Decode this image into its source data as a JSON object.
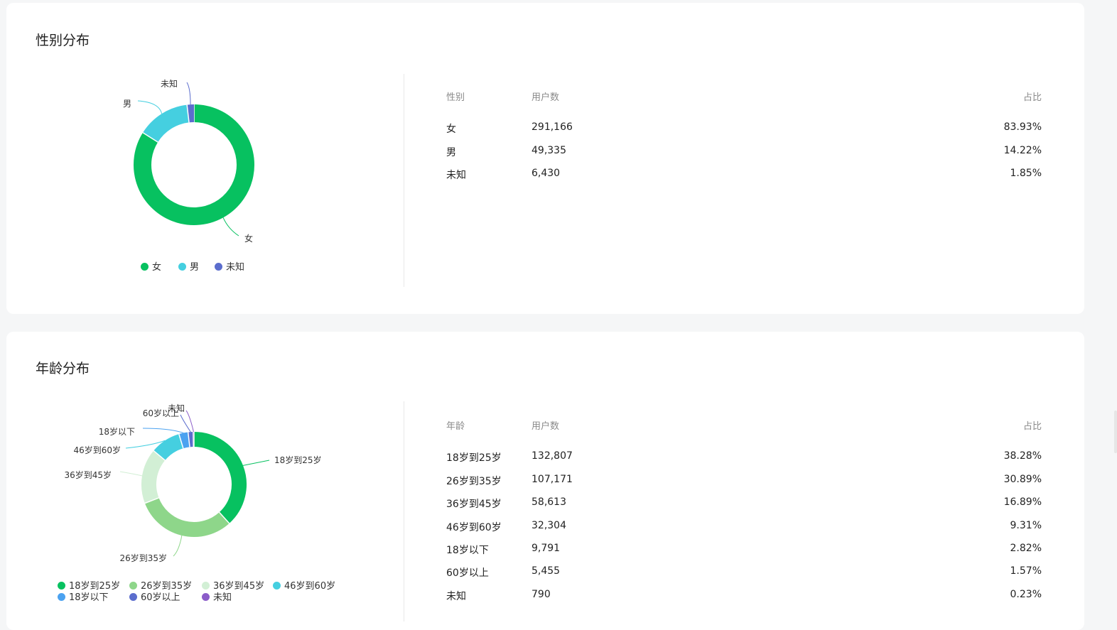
{
  "gender": {
    "title": "性别分布",
    "table": {
      "headers": [
        "性别",
        "用户数",
        "占比"
      ],
      "rows": [
        [
          "女",
          "291,166",
          "83.93%"
        ],
        [
          "男",
          "49,335",
          "14.22%"
        ],
        [
          "未知",
          "6,430",
          "1.85%"
        ]
      ]
    },
    "legend": [
      "女",
      "男",
      "未知"
    ]
  },
  "age": {
    "title": "年龄分布",
    "table": {
      "headers": [
        "年龄",
        "用户数",
        "占比"
      ],
      "rows": [
        [
          "18岁到25岁",
          "132,807",
          "38.28%"
        ],
        [
          "26岁到35岁",
          "107,171",
          "30.89%"
        ],
        [
          "36岁到45岁",
          "58,613",
          "16.89%"
        ],
        [
          "46岁到60岁",
          "32,304",
          "9.31%"
        ],
        [
          "18岁以下",
          "9,791",
          "2.82%"
        ],
        [
          "60岁以上",
          "5,455",
          "1.57%"
        ],
        [
          "未知",
          "790",
          "0.23%"
        ]
      ]
    },
    "legend": [
      "18岁到25岁",
      "26岁到35岁",
      "36岁到45岁",
      "46岁到60岁",
      "18岁以下",
      "60岁以上",
      "未知"
    ]
  },
  "chart_data": [
    {
      "type": "pie",
      "title": "性别分布",
      "categories": [
        "女",
        "男",
        "未知"
      ],
      "values": [
        291166,
        49335,
        6430
      ],
      "colors": [
        "#07c160",
        "#45cfe0",
        "#5b6dcd"
      ],
      "legend_position": "bottom"
    },
    {
      "type": "pie",
      "title": "年龄分布",
      "categories": [
        "18岁到25岁",
        "26岁到35岁",
        "36岁到45岁",
        "46岁到60岁",
        "18岁以下",
        "60岁以上",
        "未知"
      ],
      "values": [
        132807,
        107171,
        58613,
        32304,
        9791,
        5455,
        790
      ],
      "colors": [
        "#07c160",
        "#8ed68a",
        "#d2efd5",
        "#45cfe0",
        "#4ba2f0",
        "#5b6dcd",
        "#8b5cc9"
      ],
      "legend_position": "bottom"
    }
  ]
}
